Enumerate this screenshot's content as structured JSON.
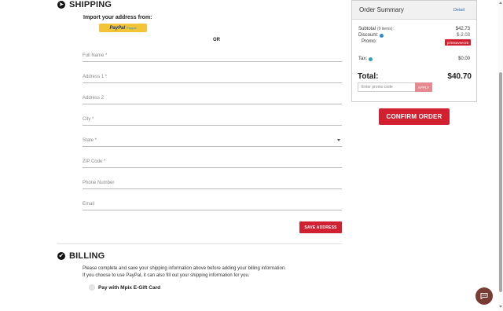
{
  "shipping": {
    "title": "SHIPPING",
    "import_label": "Import your address from:",
    "paypal_logo": "PayPal",
    "paypal_sub": "Paypal",
    "or_text": "OR",
    "fields": [
      {
        "placeholder": "Full Name *"
      },
      {
        "placeholder": "Address 1 *"
      },
      {
        "placeholder": "Address 2"
      },
      {
        "placeholder": "City *"
      },
      {
        "placeholder": "State *"
      },
      {
        "placeholder": "ZIP Code *"
      },
      {
        "placeholder": "Phone Number"
      },
      {
        "placeholder": "Email"
      }
    ],
    "save_label": "SAVE ADDRESS"
  },
  "billing": {
    "title": "BILLING",
    "message_line1": "Please complete and save your shipping information above before adding your billing information.",
    "message_line2": "If you choose to use PayPal, it can also fill out your shipping information for you.",
    "gift_card_label": "Pay with Mpix E-Gift Card"
  },
  "summary": {
    "title": "Order Summary",
    "detail_link": "Detail",
    "subtotal_label": "Subtotal",
    "subtotal_items": "(9 items):",
    "subtotal_value": "$42.73",
    "discount_label": "Discount:",
    "discount_value": "$-2.03",
    "promo_label": "Promo:",
    "promo_code": "printsaveer25",
    "tax_label": "Tax:",
    "tax_value": "$0.00",
    "total_label": "Total:",
    "total_value": "$40.70",
    "promo_placeholder": "Enter promo code",
    "apply_label": "APPLY",
    "confirm_label": "CONFIRM ORDER"
  },
  "colors": {
    "accent_red": "#d1202f",
    "info_blue": "#2b8fd6",
    "tax_info_teal": "#2aa6b3",
    "chat_brown": "#7a3b33"
  }
}
